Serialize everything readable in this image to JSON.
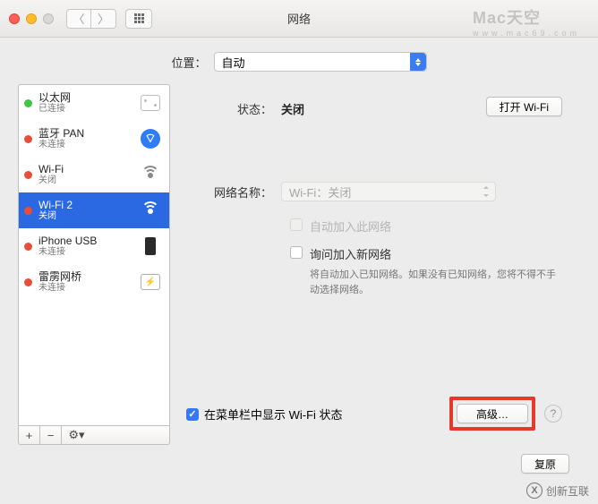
{
  "window": {
    "title": "网络"
  },
  "location": {
    "label": "位置：",
    "value": "自动"
  },
  "sidebar": {
    "items": [
      {
        "name": "以太网",
        "sub": "已连接",
        "dot": "green",
        "icon": "eth"
      },
      {
        "name": "蓝牙 PAN",
        "sub": "未连接",
        "dot": "red",
        "icon": "bt"
      },
      {
        "name": "Wi-Fi",
        "sub": "关闭",
        "dot": "red",
        "icon": "wifi-off"
      },
      {
        "name": "Wi-Fi 2",
        "sub": "关闭",
        "dot": "red",
        "icon": "wifi-sel",
        "selected": true
      },
      {
        "name": "iPhone USB",
        "sub": "未连接",
        "dot": "red",
        "icon": "iphone"
      },
      {
        "name": "雷雳网桥",
        "sub": "未连接",
        "dot": "red",
        "icon": "tb"
      }
    ],
    "actions": {
      "add": "+",
      "remove": "−",
      "gear": "⚙︎▾"
    }
  },
  "main": {
    "status_label": "状态：",
    "status_value": "关闭",
    "toggle_btn": "打开 Wi-Fi",
    "name_label": "网络名称：",
    "name_value": "Wi-Fi：关闭",
    "auto_join_label": "自动加入此网络",
    "ask_join_label": "询问加入新网络",
    "ask_join_hint": "将自动加入已知网络。如果没有已知网络，您将不得不手动选择网络。",
    "menu_bar_label": "在菜单栏中显示 Wi-Fi 状态",
    "advanced_btn": "高级…",
    "revert_btn": "复原"
  },
  "watermark": {
    "top": "Mac天空",
    "top_sub": "www.mac69.com",
    "bottom": "创新互联"
  }
}
